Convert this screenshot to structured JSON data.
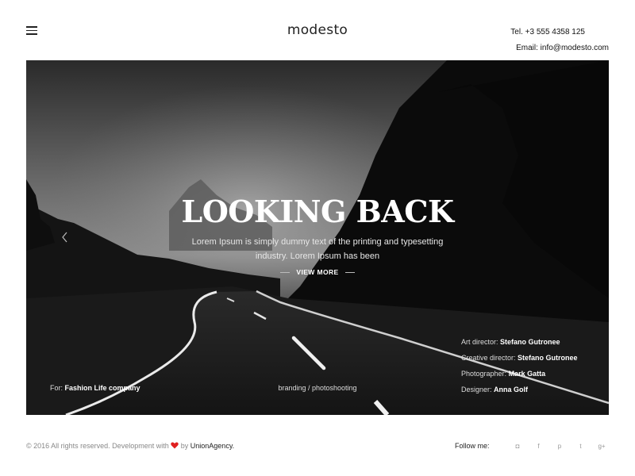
{
  "header": {
    "logo": "modesto",
    "tel": "Tel. +3 555 4358 125",
    "email": "Email: info@modesto.com"
  },
  "hero": {
    "title": "LOOKING BACK",
    "text": "Lorem Ipsum is simply dummy text of the printing and typesetting industry. Lorem Ipsum has been",
    "view_more": "VIEW MORE",
    "client_label": "For:",
    "client_value": "Fashion Life company",
    "tags": "branding / photoshooting",
    "credits": [
      {
        "label": "Art director:",
        "value": "Stefano Gutronee"
      },
      {
        "label": "Creative director:",
        "value": "Stefano Gutronee"
      },
      {
        "label": "Photographer:",
        "value": "Mark Gatta"
      },
      {
        "label": "Designer:",
        "value": "Anna Golf"
      }
    ],
    "arrow_icon": "chevron-left-icon"
  },
  "footer": {
    "copyright_pre": "© 2016 All rights reserved. Development with",
    "copyright_by": "by",
    "agency": "UnionAgency.",
    "follow_label": "Follow me:",
    "social": [
      {
        "icon": "instagram-icon",
        "glyph": "◘"
      },
      {
        "icon": "facebook-icon",
        "glyph": "f"
      },
      {
        "icon": "pinterest-icon",
        "glyph": "p"
      },
      {
        "icon": "twitter-icon",
        "glyph": "t"
      },
      {
        "icon": "google-plus-icon",
        "glyph": "g+"
      }
    ],
    "heart_color": "#e02020"
  }
}
